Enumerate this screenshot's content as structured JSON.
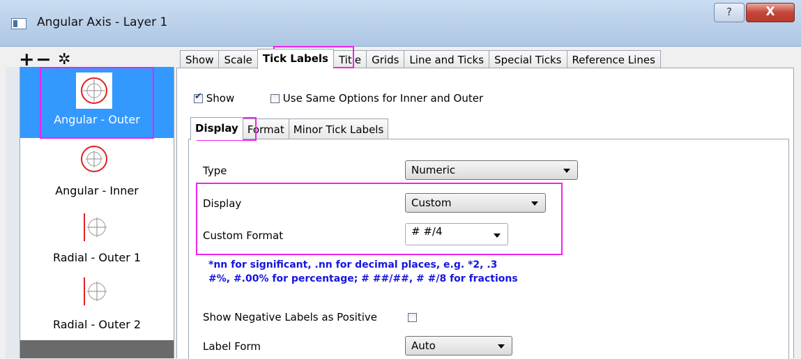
{
  "window": {
    "title": "Angular Axis - Layer 1",
    "help_label": "?",
    "close_label": "X"
  },
  "toolbar": {
    "add_label": "+",
    "remove_label": "−",
    "settings_label": "✲"
  },
  "left_panel": {
    "items": [
      {
        "label": "Angular - Outer",
        "selected": true
      },
      {
        "label": "Angular - Inner",
        "selected": false
      },
      {
        "label": "Radial - Outer 1",
        "selected": false
      },
      {
        "label": "Radial - Outer 2",
        "selected": false
      }
    ]
  },
  "tabs": [
    "Show",
    "Scale",
    "Tick Labels",
    "Title",
    "Grids",
    "Line and Ticks",
    "Special Ticks",
    "Reference Lines"
  ],
  "active_tab": "Tick Labels",
  "options": {
    "show_label": "Show",
    "show_checked": true,
    "same_options_label": "Use Same Options for Inner and Outer",
    "same_options_checked": false
  },
  "subtabs": [
    "Display",
    "Format",
    "Minor Tick Labels"
  ],
  "active_subtab": "Display",
  "display": {
    "type_label": "Type",
    "type_value": "Numeric",
    "display_label": "Display",
    "display_value": "Custom",
    "custom_format_label": "Custom Format",
    "custom_format_value": "# #/4",
    "hint_line1": "*nn for significant, .nn for decimal places, e.g. *2, .3",
    "hint_line2": "#%, #.00% for percentage; # ##/##, # #/8 for fractions",
    "negative_label": "Show Negative Labels as Positive",
    "negative_checked": false,
    "label_form_label": "Label Form",
    "label_form_value": "Auto"
  },
  "colors": {
    "highlight": "#ee22ee",
    "selection": "#3399ff",
    "hint": "#1515e0",
    "icon_red": "#e02020"
  }
}
